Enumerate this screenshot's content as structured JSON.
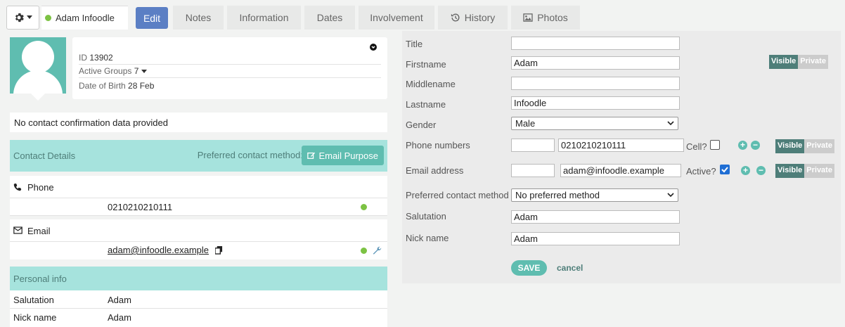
{
  "header": {
    "person_name": "Adam Infoodle",
    "tabs": [
      {
        "label": "Edit",
        "icon": ""
      },
      {
        "label": "Notes",
        "icon": ""
      },
      {
        "label": "Information",
        "icon": ""
      },
      {
        "label": "Dates",
        "icon": ""
      },
      {
        "label": "Involvement",
        "icon": ""
      },
      {
        "label": "History",
        "icon": "history-icon"
      },
      {
        "label": "Photos",
        "icon": "image-icon"
      }
    ]
  },
  "profile": {
    "id_label": "ID",
    "id_value": "13902",
    "groups_label": "Active Groups",
    "groups_value": "7",
    "dob_label": "Date of Birth",
    "dob_value": "28 Feb"
  },
  "confirmation_text": "No contact confirmation data provided",
  "contact_details": {
    "title": "Contact Details",
    "pref_label": "Preferred contact method:",
    "email_purpose_label": "Email Purpose",
    "phone_label": "Phone",
    "phone_value": "0210210210111",
    "email_label": "Email",
    "email_value": "adam@infoodle.example"
  },
  "personal_info": {
    "title": "Personal info",
    "rows": [
      {
        "label": "Salutation",
        "value": "Adam"
      },
      {
        "label": "Nick name",
        "value": "Adam"
      }
    ]
  },
  "form": {
    "title_label": "Title",
    "title_value": "",
    "firstname_label": "Firstname",
    "firstname_value": "Adam",
    "middlename_label": "Middlename",
    "middlename_value": "",
    "lastname_label": "Lastname",
    "lastname_value": "Infoodle",
    "gender_label": "Gender",
    "gender_value": "Male",
    "phone_label": "Phone numbers",
    "phone_prefix": "",
    "phone_value": "0210210210111",
    "cell_label": "Cell?",
    "cell_checked": false,
    "email_label": "Email address",
    "email_prefix": "",
    "email_value": "adam@infoodle.example",
    "active_label": "Active?",
    "active_checked": true,
    "pref_label": "Preferred contact method",
    "pref_value": "No preferred method",
    "salutation_label": "Salutation",
    "salutation_value": "Adam",
    "nickname_label": "Nick name",
    "nickname_value": "Adam",
    "visible_label": "Visible",
    "private_label": "Private",
    "save_label": "SAVE",
    "cancel_label": "cancel"
  },
  "colors": {
    "teal": "#5fbdb0",
    "teal_light": "#a6e3dd",
    "teal_dark": "#4e7e79",
    "edit_blue": "#5b7fc4",
    "status_green": "#7cc243"
  }
}
